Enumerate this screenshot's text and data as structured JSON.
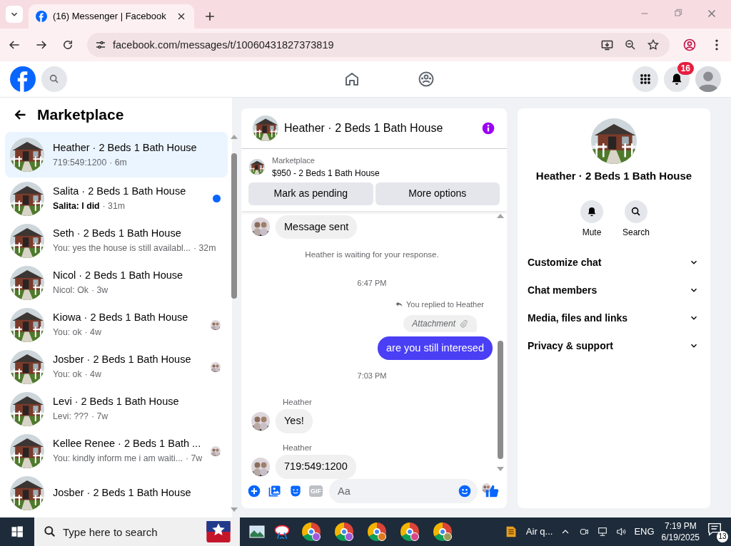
{
  "browser": {
    "tab_title": "(16) Messenger | Facebook",
    "url": "facebook.com/messages/t/10060431827373819"
  },
  "topnav": {
    "notification_count": "16"
  },
  "sidebar": {
    "title": "Marketplace",
    "conversations": [
      {
        "name": "Heather · 2 Beds 1 Bath House",
        "preview": "719:549:1200",
        "time": "· 6m",
        "selected": true,
        "unread": false,
        "seen_avatar": false
      },
      {
        "name": "Salita · 2 Beds 1 Bath House",
        "preview": "Salita: I did",
        "time": "· 31m",
        "selected": false,
        "unread": true,
        "seen_avatar": false
      },
      {
        "name": "Seth · 2 Beds 1 Bath House",
        "preview": "You: yes the house is still availabl...",
        "time": "· 32m",
        "selected": false,
        "unread": false,
        "seen_avatar": false
      },
      {
        "name": "Nicol · 2 Beds 1 Bath House",
        "preview": "Nicol: Ok",
        "time": "· 3w",
        "selected": false,
        "unread": false,
        "seen_avatar": false
      },
      {
        "name": "Kiowa · 2 Beds 1 Bath House",
        "preview": "You: ok",
        "time": "· 4w",
        "selected": false,
        "unread": false,
        "seen_avatar": true
      },
      {
        "name": "Josber · 2 Beds 1 Bath House",
        "preview": "You: ok",
        "time": "· 4w",
        "selected": false,
        "unread": false,
        "seen_avatar": true
      },
      {
        "name": "Levi · 2 Beds 1 Bath House",
        "preview": "Levi: ???",
        "time": "· 7w",
        "selected": false,
        "unread": false,
        "seen_avatar": false
      },
      {
        "name": "Kellee Renee · 2 Beds 1 Bath ...",
        "preview": "You: kindly inform me i am waiti...",
        "time": "· 7w",
        "selected": false,
        "unread": false,
        "seen_avatar": true
      },
      {
        "name": "Josber · 2 Beds 1 Bath House",
        "selected": false,
        "unread": false,
        "seen_avatar": false
      }
    ]
  },
  "chat": {
    "title": "Heather · 2 Beds 1 Bath House",
    "listing": {
      "label": "Marketplace",
      "title": "$950 - 2 Beds 1 Bath House"
    },
    "buttons": [
      "Mark as pending",
      "More options"
    ],
    "messages": [
      {
        "kind": "incoming",
        "text": "Message sent"
      },
      {
        "kind": "notice",
        "text": "Heather is waiting for your response."
      },
      {
        "kind": "time",
        "text": "6:47 PM"
      },
      {
        "kind": "reply_note",
        "text": "You replied to Heather"
      },
      {
        "kind": "attachment",
        "text": "Attachment"
      },
      {
        "kind": "outgoing",
        "text": "are you still interesed"
      },
      {
        "kind": "time",
        "text": "7:03 PM"
      },
      {
        "kind": "incoming",
        "sender": "Heather",
        "text": "Yes!"
      },
      {
        "kind": "incoming",
        "sender": "Heather",
        "text": "719:549:1200"
      }
    ],
    "seen": true,
    "composer": {
      "gif_label": "GIF",
      "placeholder": "Aa"
    }
  },
  "details": {
    "title": "Heather · 2 Beds 1 Bath House",
    "actions": [
      {
        "kind": "mute",
        "label": "Mute"
      },
      {
        "kind": "search",
        "label": "Search"
      }
    ],
    "sections": [
      {
        "label": "Customize chat",
        "expanded": false
      },
      {
        "label": "Chat members",
        "expanded": false
      },
      {
        "label": "Media, files and links",
        "expanded": false
      },
      {
        "label": "Privacy & support",
        "expanded": false
      }
    ]
  },
  "taskbar": {
    "search_placeholder": "Type here to search",
    "weather": "Air q...",
    "language": "ENG",
    "time": "7:19 PM",
    "date": "6/19/2025",
    "notifications": "13"
  }
}
